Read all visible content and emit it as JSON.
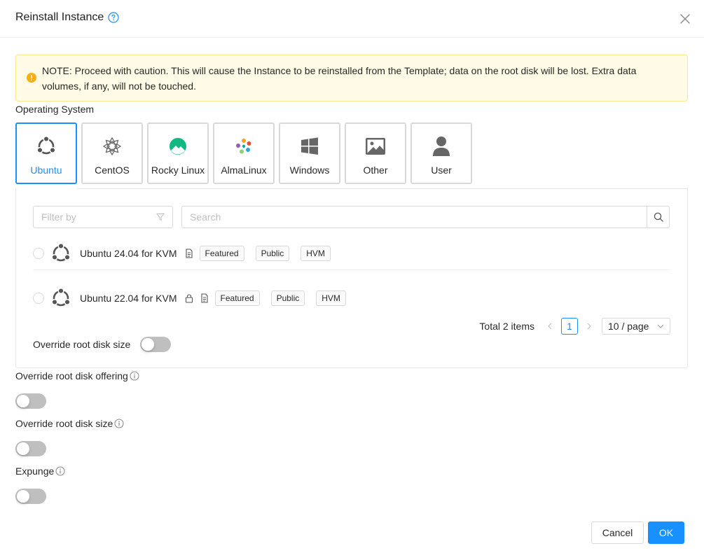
{
  "dialog": {
    "title": "Reinstall Instance",
    "note": "NOTE: Proceed with caution. This will cause the Instance to be reinstalled from the Template; data on the root disk will be lost. Extra data volumes, if any, will not be touched."
  },
  "os": {
    "label": "Operating System",
    "options": [
      {
        "name": "Ubuntu",
        "icon": "ubuntu-icon",
        "selected": true
      },
      {
        "name": "CentOS",
        "icon": "centos-icon"
      },
      {
        "name": "Rocky Linux",
        "icon": "rocky-linux-icon"
      },
      {
        "name": "AlmaLinux",
        "icon": "almalinux-icon"
      },
      {
        "name": "Windows",
        "icon": "windows-icon"
      },
      {
        "name": "Other",
        "icon": "image-icon"
      },
      {
        "name": "User",
        "icon": "user-icon"
      }
    ]
  },
  "filters": {
    "filter_placeholder": "Filter by",
    "search_placeholder": "Search"
  },
  "templates": [
    {
      "name": "Ubuntu 24.04 for KVM",
      "tags": [
        "Featured",
        "Public",
        "HVM"
      ]
    },
    {
      "name": "Ubuntu 22.04 for KVM",
      "tags": [
        "Featured",
        "Public",
        "HVM"
      ]
    }
  ],
  "pagination": {
    "total": "Total 2 items",
    "current": "1",
    "page_size": "10 / page"
  },
  "inner_override_label": "Override root disk size",
  "fields": {
    "override_offering": "Override root disk offering",
    "override_size": "Override root disk size",
    "expunge": "Expunge"
  },
  "buttons": {
    "cancel": "Cancel",
    "ok": "OK"
  },
  "colors": {
    "primary": "#1890ff",
    "warning_bg": "#fffbe6",
    "warning_icon": "#faad14",
    "rocky_green": "#10b981"
  }
}
